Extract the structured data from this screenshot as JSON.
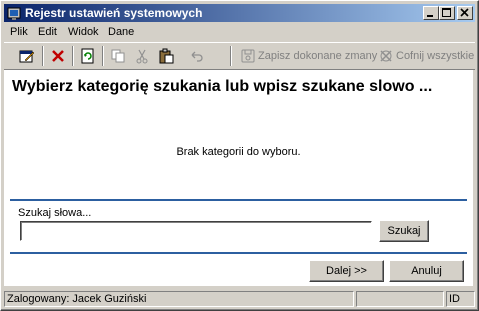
{
  "window": {
    "title": "Rejestr ustawień systemowych"
  },
  "menu": [
    "Plik",
    "Edit",
    "Widok",
    "Dane"
  ],
  "toolbar": {
    "save_changes_label": "Zapisz dokonane zmany",
    "undo_all_label": "Cofnij wszystkie"
  },
  "main": {
    "heading": "Wybierz kategorię szukania  lub wpisz szukane slowo ...",
    "empty_message": "Brak kategorii do wyboru.",
    "search_label": "Szukaj słowa...",
    "search_value": "",
    "search_button": "Szukaj",
    "next_button": "Dalej >>",
    "cancel_button": "Anuluj"
  },
  "status": {
    "user": "Zalogowany: Jacek Guziński",
    "pane2": "",
    "pane3": "ID"
  }
}
